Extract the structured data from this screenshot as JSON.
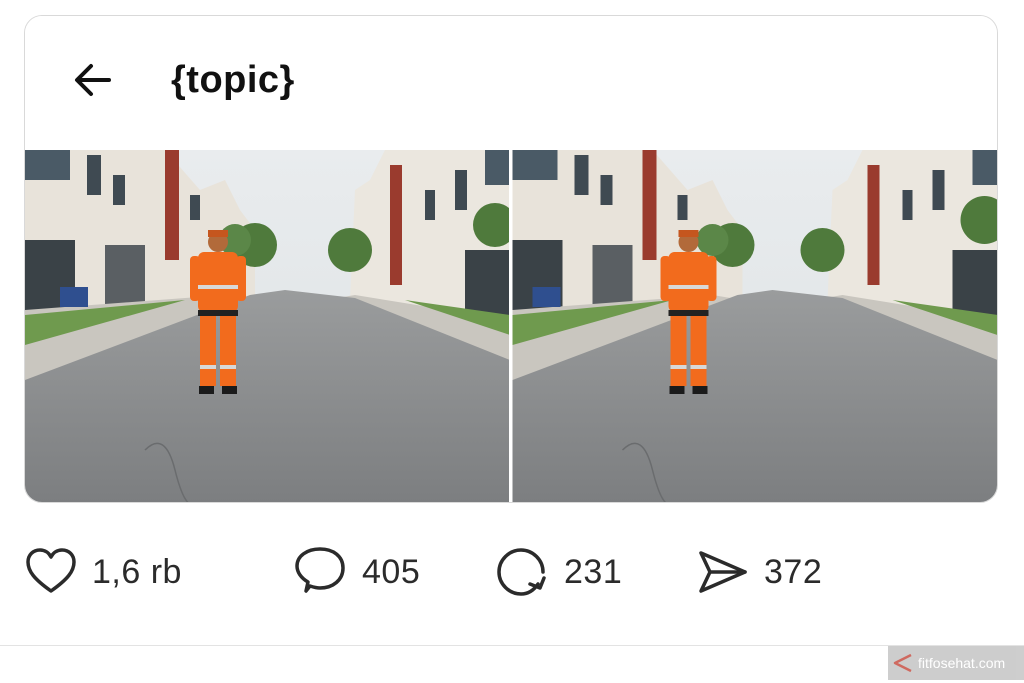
{
  "header": {
    "back_icon": "arrow-left-icon",
    "title": "{topic}"
  },
  "media": {
    "photos": [
      {
        "subject": "person-in-orange-safety-uniform-on-street"
      },
      {
        "subject": "person-in-orange-safety-uniform-on-street"
      }
    ]
  },
  "actions": {
    "like": {
      "icon": "heart-icon",
      "count": "1,6 rb"
    },
    "comment": {
      "icon": "speech-bubble-icon",
      "count": "405"
    },
    "repost": {
      "icon": "repost-icon",
      "count": "231"
    },
    "share": {
      "icon": "send-icon",
      "count": "372"
    }
  },
  "watermark": {
    "text": "fitfosehat.com",
    "accent": "#c0392b"
  }
}
